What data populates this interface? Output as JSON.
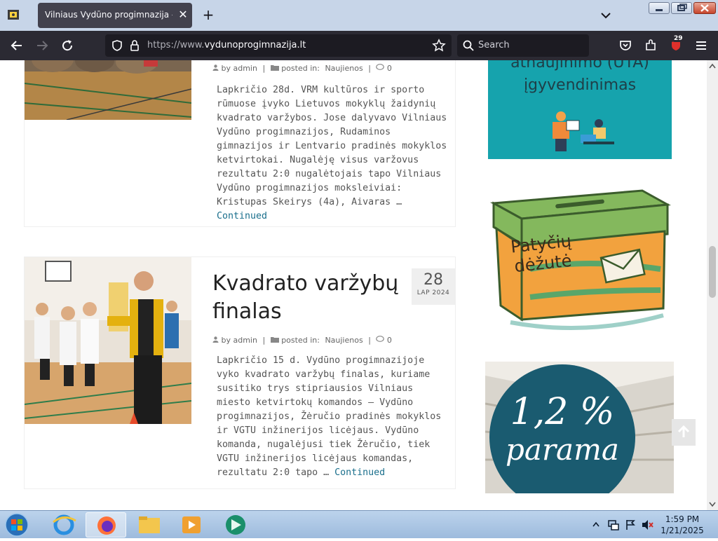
{
  "browser": {
    "tab_title": "Vilniaus Vydūno progimnazija - Vilniaus",
    "tab_close": "✕",
    "new_tab": "+",
    "url_prefix": "https://www.",
    "url_domain": "vydunoprogimnazija.lt",
    "search_placeholder": "Search",
    "extensions_badge": "29"
  },
  "posts": [
    {
      "meta_author": "by admin",
      "meta_sep1": "|",
      "meta_posted": "posted in:",
      "meta_category": "Naujienos",
      "meta_sep2": "|",
      "meta_comments": "0",
      "excerpt": "Lapkričio 28d. VRM kultūros ir sporto rūmuose įvyko Lietuvos mokyklų žaidynių kvadrato varžybos. Jose dalyvavo Vilniaus Vydūno progimnazijos, Rudaminos gimnazijos ir Lentvario pradinės mokyklos ketvirtokai. Nugalėję visus varžovus rezultatu 2:0 nugalėtojais tapo Vilniaus Vydūno progimnazijos moksleiviai: Kristupas Skeirys (4a), Aivaras …",
      "continued": "Continued"
    },
    {
      "title": "Kvadrato varžybų finalas",
      "date_day": "28",
      "date_month": "LAP 2024",
      "meta_author": "by admin",
      "meta_sep1": "|",
      "meta_posted": "posted in:",
      "meta_category": "Naujienos",
      "meta_sep2": "|",
      "meta_comments": "0",
      "excerpt": "Lapkričio 15 d. Vydūno progimnazijoje vyko kvadrato varžybų finalas, kuriame susitiko trys stipriausios Vilniaus miesto ketvirtokų komandos – Vydūno progimnazijos, Žėručio pradinės mokyklos ir VGTU inžinerijos licėjaus. Vydūno komanda, nugalėjusi tiek Žėručio, tiek VGTU inžinerijos licėjaus komandas, rezultatu 2:0 tapo …",
      "continued": "Continued"
    }
  ],
  "sidebar": {
    "uta_line1": "atnaujinimo (UTA)",
    "uta_line2": "įgyvendinimas",
    "box_line1": "Patyčių",
    "box_line2": "dėžutė",
    "parama_line1": "1,2 %",
    "parama_line2": "parama"
  },
  "taskbar": {
    "time": "1:59 PM",
    "date": "1/21/2025"
  },
  "colors": {
    "accent": "#1a6f8c",
    "teal_banner": "#16a3ad",
    "dark_chrome": "#2b2a33"
  }
}
